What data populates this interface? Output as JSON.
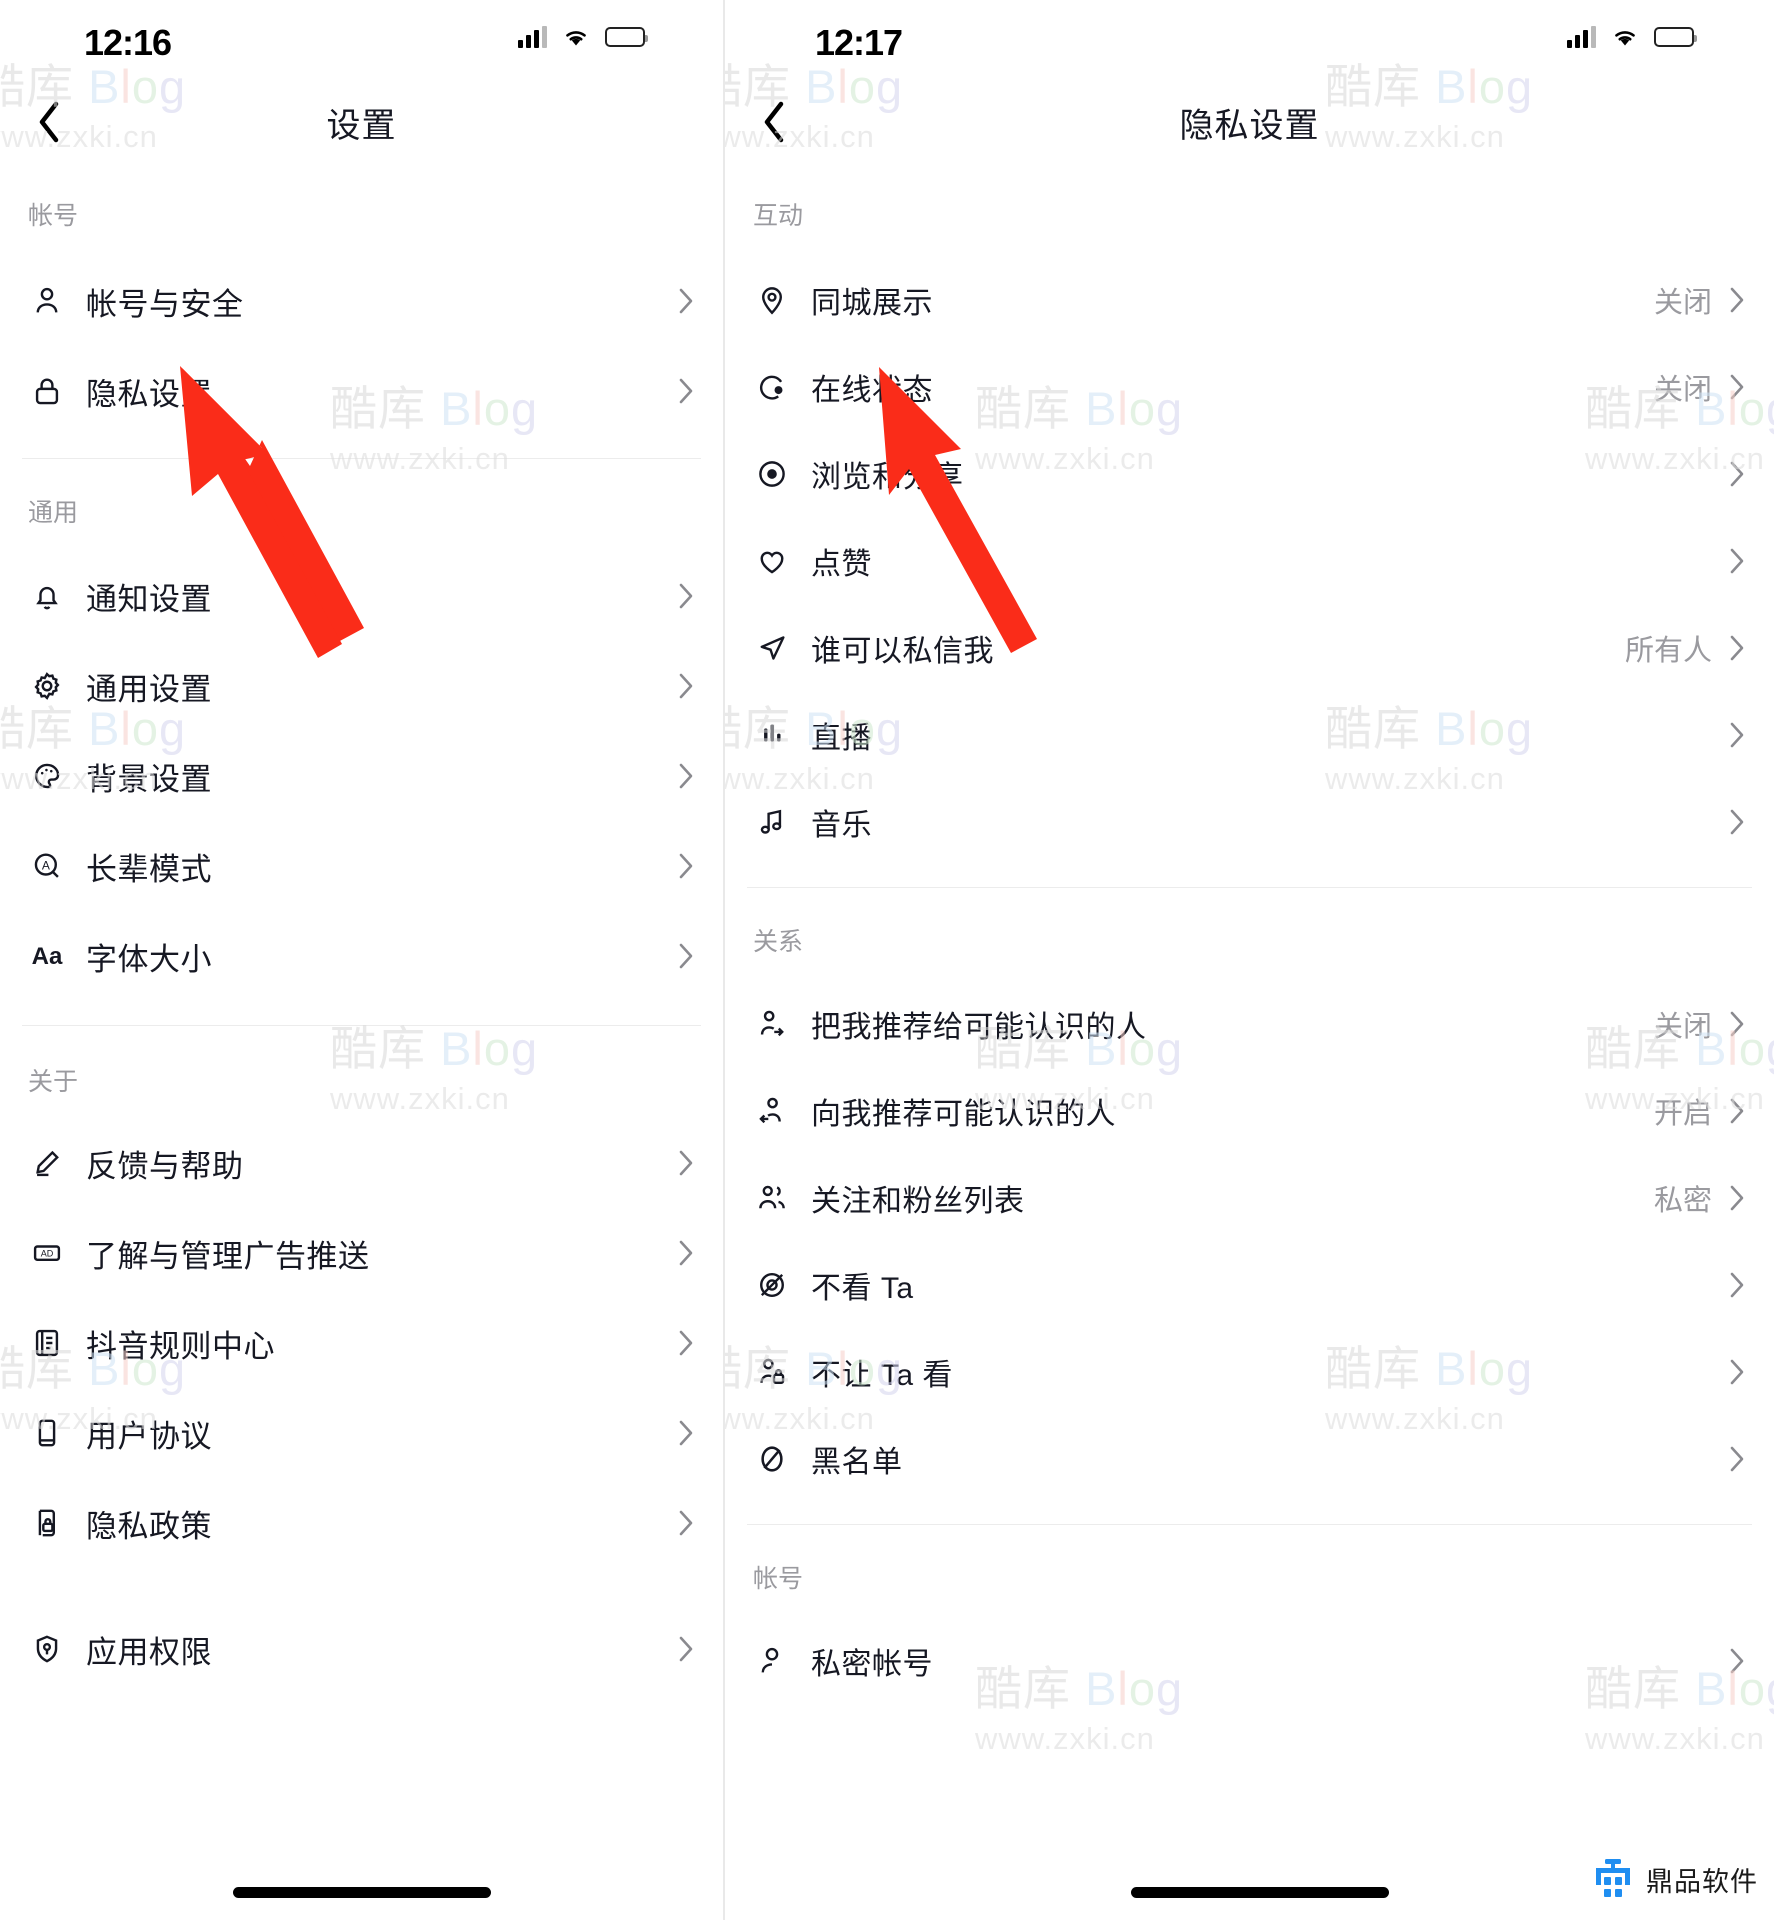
{
  "left_screen": {
    "status": {
      "time": "12:16",
      "signal_icon": "cellular-bars-icon",
      "wifi_icon": "wifi-icon",
      "battery_icon": "battery-icon"
    },
    "nav": {
      "back_icon": "chevron-left-icon",
      "title": "设置"
    },
    "sections": [
      {
        "label": "帐号",
        "items": [
          {
            "icon": "person-icon",
            "label": "帐号与安全",
            "value": "",
            "chevron": "chevron-right-icon"
          },
          {
            "icon": "lock-icon",
            "label": "隐私设置",
            "value": "",
            "chevron": "chevron-right-icon"
          }
        ]
      },
      {
        "label": "通用",
        "items": [
          {
            "icon": "bell-icon",
            "label": "通知设置",
            "value": "",
            "chevron": "chevron-right-icon"
          },
          {
            "icon": "gear-icon",
            "label": "通用设置",
            "value": "",
            "chevron": "chevron-right-icon"
          },
          {
            "icon": "palette-icon",
            "label": "背景设置",
            "value": "",
            "chevron": "chevron-right-icon"
          },
          {
            "icon": "elder-mode-icon",
            "label": "长辈模式",
            "value": "",
            "chevron": "chevron-right-icon"
          },
          {
            "icon": "font-size-icon",
            "label": "字体大小",
            "value": "",
            "chevron": "chevron-right-icon"
          }
        ]
      },
      {
        "label": "关于",
        "items": [
          {
            "icon": "pencil-icon",
            "label": "反馈与帮助",
            "value": "",
            "chevron": "chevron-right-icon"
          },
          {
            "icon": "ad-icon",
            "label": "了解与管理广告推送",
            "value": "",
            "chevron": "chevron-right-icon"
          },
          {
            "icon": "rulebook-icon",
            "label": "抖音规则中心",
            "value": "",
            "chevron": "chevron-right-icon"
          },
          {
            "icon": "document-icon",
            "label": "用户协议",
            "value": "",
            "chevron": "chevron-right-icon"
          },
          {
            "icon": "privacy-doc-icon",
            "label": "隐私政策",
            "value": "",
            "chevron": "chevron-right-icon"
          },
          {
            "icon": "shield-icon",
            "label": "应用权限",
            "value": "",
            "chevron": "chevron-right-icon"
          }
        ]
      }
    ]
  },
  "right_screen": {
    "status": {
      "time": "12:17",
      "signal_icon": "cellular-bars-icon",
      "wifi_icon": "wifi-icon",
      "battery_icon": "battery-icon"
    },
    "nav": {
      "back_icon": "chevron-left-icon",
      "title": "隐私设置"
    },
    "sections": [
      {
        "label": "互动",
        "items": [
          {
            "icon": "location-pin-icon",
            "label": "同城展示",
            "value": "关闭",
            "chevron": "chevron-right-icon"
          },
          {
            "icon": "online-status-icon",
            "label": "在线状态",
            "value": "关闭",
            "chevron": "chevron-right-icon"
          },
          {
            "icon": "eye-icon",
            "label": "浏览和分享",
            "value": "",
            "chevron": "chevron-right-icon"
          },
          {
            "icon": "heart-icon",
            "label": "点赞",
            "value": "",
            "chevron": "chevron-right-icon"
          },
          {
            "icon": "paper-plane-icon",
            "label": "谁可以私信我",
            "value": "所有人",
            "chevron": "chevron-right-icon"
          },
          {
            "icon": "live-bars-icon",
            "label": "直播",
            "value": "",
            "chevron": "chevron-right-icon"
          },
          {
            "icon": "music-note-icon",
            "label": "音乐",
            "value": "",
            "chevron": "chevron-right-icon"
          }
        ]
      },
      {
        "label": "关系",
        "items": [
          {
            "icon": "person-share-icon",
            "label": "把我推荐给可能认识的人",
            "value": "关闭",
            "chevron": "chevron-right-icon"
          },
          {
            "icon": "person-suggest-icon",
            "label": "向我推荐可能认识的人",
            "value": "开启",
            "chevron": "chevron-right-icon"
          },
          {
            "icon": "people-icon",
            "label": "关注和粉丝列表",
            "value": "私密",
            "chevron": "chevron-right-icon"
          },
          {
            "icon": "eye-off-icon",
            "label": "不看 Ta",
            "value": "",
            "chevron": "chevron-right-icon"
          },
          {
            "icon": "person-lock-icon",
            "label": "不让 Ta 看",
            "value": "",
            "chevron": "chevron-right-icon"
          },
          {
            "icon": "block-icon",
            "label": "黑名单",
            "value": "",
            "chevron": "chevron-right-icon"
          }
        ]
      },
      {
        "label": "帐号",
        "items": [
          {
            "icon": "private-account-icon",
            "label": "私密帐号",
            "value": "",
            "chevron": "chevron-right-icon"
          }
        ]
      }
    ]
  },
  "watermark": {
    "brand_cn": "酷库",
    "brand_en": "Blog",
    "url": "www.zxki.cn"
  },
  "brand_footer": {
    "name": "鼎品软件",
    "logo_icon": "dingpin-logo-icon",
    "color": "#1f8ef1"
  },
  "annotations": {
    "arrow_color": "#fa2c19",
    "left_arrow_target": "隐私设置",
    "right_arrow_target": "在线状态"
  }
}
